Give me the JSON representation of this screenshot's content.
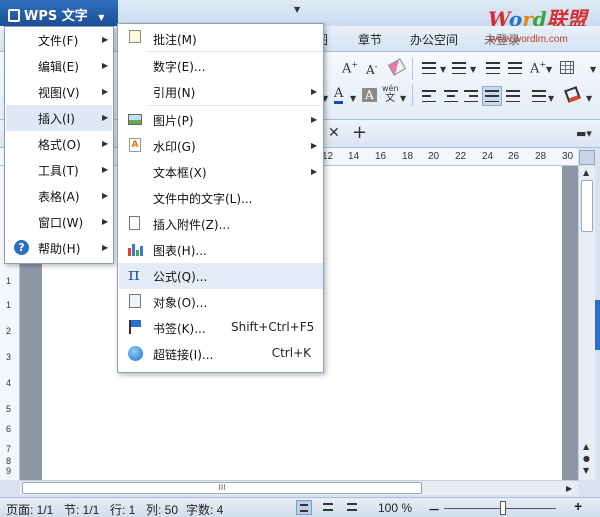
{
  "app": {
    "title": "WPS 文字"
  },
  "brand": {
    "logo_word": "Word",
    "logo_cn": "联盟",
    "url": "www.wordlm.com"
  },
  "ribbon": {
    "tabs": [
      {
        "label": "图"
      },
      {
        "label": "章节"
      },
      {
        "label": "办公空间"
      },
      {
        "label": "未登录"
      }
    ],
    "font_buttons": {
      "grow": "A",
      "shrink": "A",
      "font_color": "A",
      "char_shade": "A",
      "phonetic_top": "wén",
      "phonetic_bottom": "文"
    }
  },
  "main_menu": {
    "items": [
      {
        "label": "文件(F)",
        "has_submenu": true
      },
      {
        "label": "编辑(E)",
        "has_submenu": true
      },
      {
        "label": "视图(V)",
        "has_submenu": true
      },
      {
        "label": "插入(I)",
        "has_submenu": true
      },
      {
        "label": "格式(O)",
        "has_submenu": true
      },
      {
        "label": "工具(T)",
        "has_submenu": true
      },
      {
        "label": "表格(A)",
        "has_submenu": true
      },
      {
        "label": "窗口(W)",
        "has_submenu": true
      },
      {
        "label": "帮助(H)",
        "has_submenu": true,
        "icon": "help-icon"
      }
    ]
  },
  "insert_menu": {
    "items": [
      {
        "label": "批注(M)",
        "icon": "comment-icon"
      },
      {
        "label": "数字(E)...",
        "icon": ""
      },
      {
        "label": "引用(N)",
        "icon": "",
        "has_submenu": true
      },
      {
        "label": "图片(P)",
        "icon": "picture-icon",
        "has_submenu": true
      },
      {
        "label": "水印(G)",
        "icon": "watermark-icon",
        "has_submenu": true
      },
      {
        "label": "文本框(X)",
        "icon": "",
        "has_submenu": true
      },
      {
        "label": "文件中的文字(L)...",
        "icon": ""
      },
      {
        "label": "插入附件(Z)...",
        "icon": "attachment-icon"
      },
      {
        "label": "图表(H)...",
        "icon": "chart-icon"
      },
      {
        "label": "公式(Q)...",
        "icon": "formula-icon",
        "glyph": "π"
      },
      {
        "label": "对象(O)...",
        "icon": "object-icon"
      },
      {
        "label": "书签(K)...",
        "icon": "bookmark-icon",
        "shortcut": "Shift+Ctrl+F5"
      },
      {
        "label": "超链接(I)...",
        "icon": "hyperlink-icon",
        "shortcut": "Ctrl+K"
      }
    ]
  },
  "ruler": {
    "horizontal_ticks": [
      "12",
      "14",
      "16",
      "18",
      "20",
      "22",
      "24",
      "26",
      "28",
      "30"
    ],
    "vertical_ticks": [
      "1",
      "1",
      "2",
      "3",
      "4",
      "5",
      "6",
      "7",
      "8",
      "9"
    ]
  },
  "scrollbar": {
    "h_thumb_grip": "III"
  },
  "status": {
    "page": "页面: 1/1",
    "section": "节: 1/1",
    "line": "行: 1",
    "column": "列: 50",
    "word_count": "字数: 4",
    "zoom": "100 %",
    "zoom_out": "－",
    "zoom_in": "+"
  },
  "colors": {
    "title_blue": "#1d4f96",
    "ribbon_bg": "#e3ecf7",
    "menu_hover": "#dfe8f6",
    "brand_red": "#d62f2f",
    "brand_blue": "#2a6fc9",
    "brand_green": "#3aa63a"
  }
}
